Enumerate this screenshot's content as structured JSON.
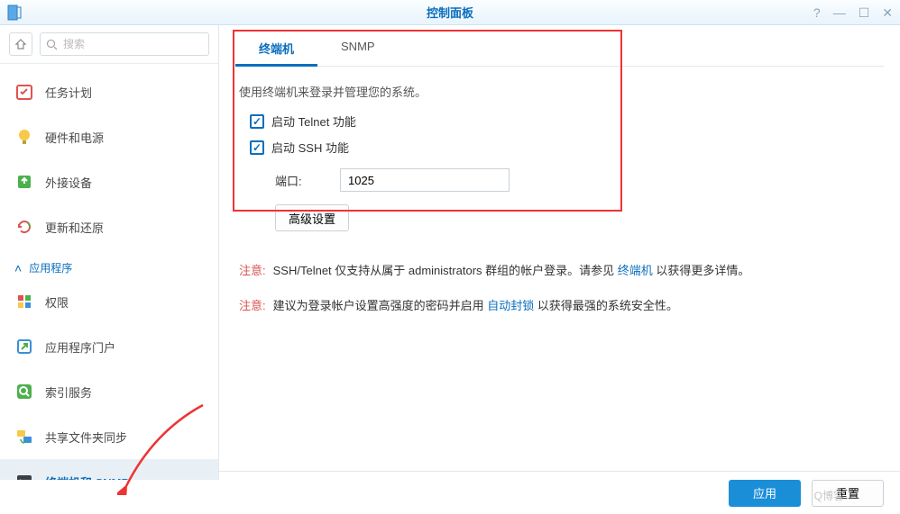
{
  "window": {
    "title": "控制面板"
  },
  "search": {
    "placeholder": "搜索"
  },
  "sidebar": {
    "items": [
      {
        "label": "任务计划"
      },
      {
        "label": "硬件和电源"
      },
      {
        "label": "外接设备"
      },
      {
        "label": "更新和还原"
      }
    ],
    "section": "应用程序",
    "appItems": [
      {
        "label": "权限"
      },
      {
        "label": "应用程序门户"
      },
      {
        "label": "索引服务"
      },
      {
        "label": "共享文件夹同步"
      },
      {
        "label": "终端机和 SNMP"
      }
    ]
  },
  "tabs": {
    "terminal": "终端机",
    "snmp": "SNMP"
  },
  "panel": {
    "description": "使用终端机来登录并管理您的系统。",
    "telnet_label": "启动 Telnet 功能",
    "ssh_label": "启动 SSH 功能",
    "port_label": "端口:",
    "port_value": "1025",
    "advanced_label": "高级设置"
  },
  "notes": {
    "warn": "注意:",
    "line1_a": "SSH/Telnet 仅支持从属于 administrators 群组的帐户登录。请参见 ",
    "line1_link": "终端机",
    "line1_b": " 以获得更多详情。",
    "line2_a": "建议为登录帐户设置高强度的密码并启用 ",
    "line2_link": "自动封锁",
    "line2_b": " 以获得最强的系统安全性。"
  },
  "footer": {
    "apply": "应用",
    "reset": "重置"
  },
  "watermark": "Q博客"
}
